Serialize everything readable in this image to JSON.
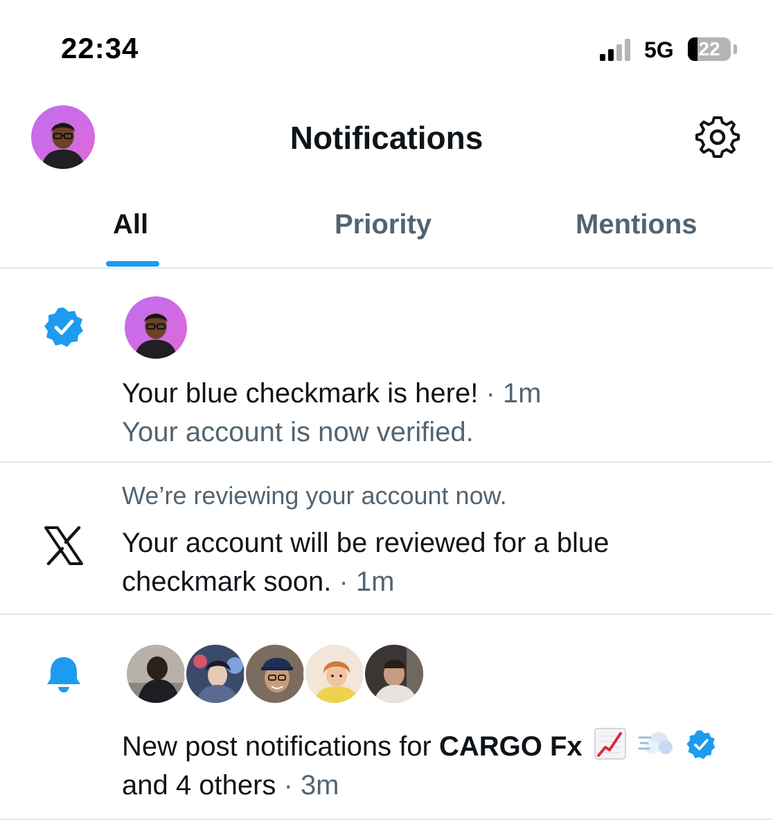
{
  "status_bar": {
    "time": "22:34",
    "network": "5G",
    "battery_percent": "22",
    "battery_level": 0.22,
    "signal_bars_active": 2,
    "signal_bars_total": 4
  },
  "header": {
    "title": "Notifications",
    "avatar_icon": "user-avatar",
    "settings_icon": "gear-icon"
  },
  "tabs": [
    {
      "label": "All",
      "active": true
    },
    {
      "label": "Priority",
      "active": false
    },
    {
      "label": "Mentions",
      "active": false
    }
  ],
  "notifications": [
    {
      "icon": "verified-badge-icon",
      "title": "Your blue checkmark is here!",
      "separator": " · ",
      "time": "1m",
      "subtitle": "Your account is now verified."
    },
    {
      "icon": "x-logo-icon",
      "pre_text": "We’re reviewing your account now.",
      "body": "Your account will be reviewed for a blue checkmark soon.",
      "separator": " · ",
      "time": "1m"
    },
    {
      "icon": "bell-icon",
      "prefix": "New post notifications for ",
      "account": "CARGO Fx",
      "emojis": [
        "chart-increasing-emoji",
        "dash-emoji"
      ],
      "suffix": "and 4 others",
      "separator": " · ",
      "time": "3m"
    }
  ],
  "colors": {
    "accent": "#1d9bf0",
    "text_primary": "#0f1419",
    "text_secondary": "#536471",
    "divider": "#e3e6e9"
  }
}
